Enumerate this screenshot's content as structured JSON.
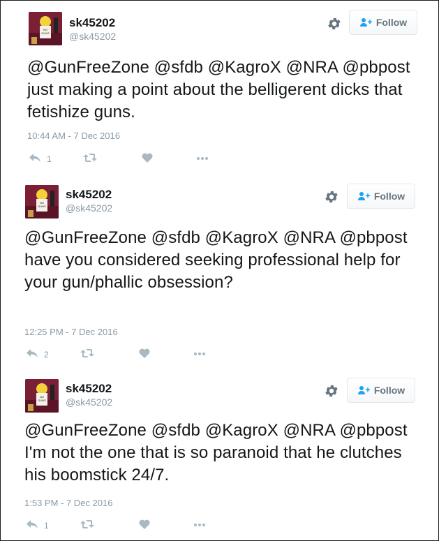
{
  "tweets": [
    {
      "username": "sk45202",
      "handle": "@sk45202",
      "follow_label": "Follow",
      "text": "@GunFreeZone @sfdb @KagroX @NRA @pbpost just making a point about the belligerent dicks that fetishize guns.",
      "timestamp": "10:44 AM - 7 Dec 2016",
      "reply_count": "1",
      "icons": [
        "settings-gear-icon",
        "follow-person-icon",
        "reply-icon",
        "retweet-icon",
        "heart-icon",
        "more-dots-icon"
      ]
    },
    {
      "username": "sk45202",
      "handle": "@sk45202",
      "follow_label": "Follow",
      "text": "@GunFreeZone @sfdb @KagroX @NRA @pbpost have you considered seeking professional help for your gun/phallic obsession?",
      "timestamp": "12:25 PM - 7 Dec 2016",
      "reply_count": "2",
      "icons": [
        "settings-gear-icon",
        "follow-person-icon",
        "reply-icon",
        "retweet-icon",
        "heart-icon",
        "more-dots-icon"
      ]
    },
    {
      "username": "sk45202",
      "handle": "@sk45202",
      "follow_label": "Follow",
      "text": "@GunFreeZone @sfdb @KagroX @NRA @pbpost I'm not the one that is so paranoid that he clutches his boomstick 24/7.",
      "timestamp": "1:53 PM - 7 Dec 2016",
      "reply_count": "1",
      "icons": [
        "settings-gear-icon",
        "follow-person-icon",
        "reply-icon",
        "retweet-icon",
        "heart-icon",
        "more-dots-icon"
      ]
    }
  ],
  "colors": {
    "text": "#14171a",
    "muted": "#8899a6",
    "icon": "#aab8c2",
    "button_text": "#66757f",
    "avatar_bg": "#7a1f35"
  }
}
